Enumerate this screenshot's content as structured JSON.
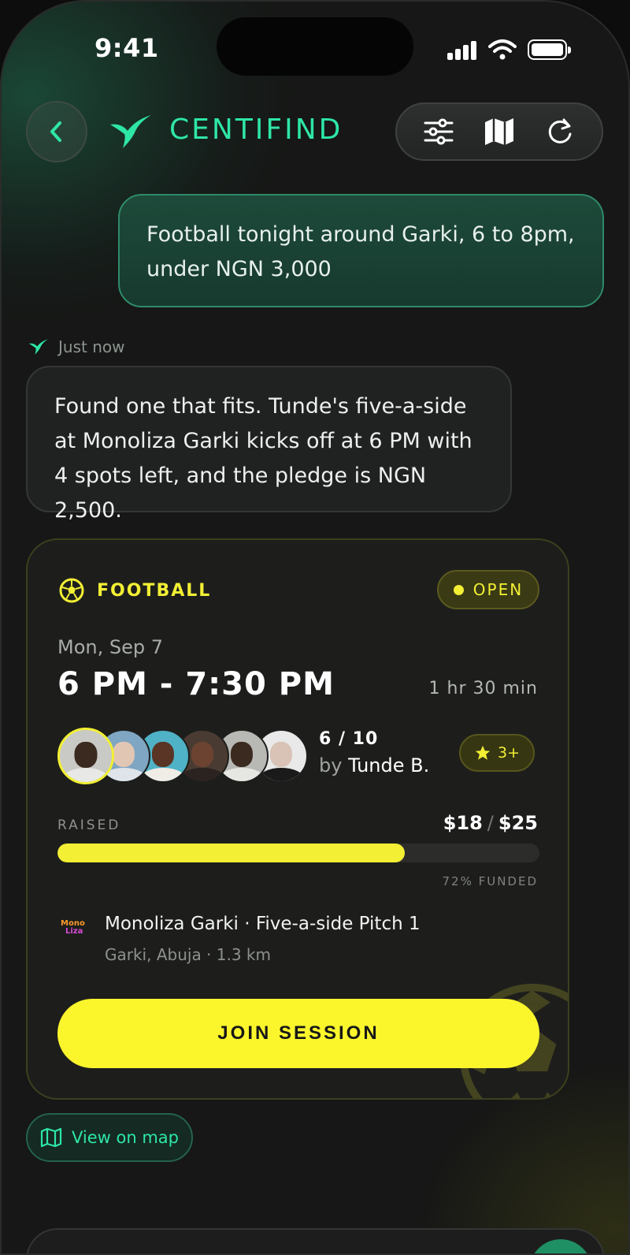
{
  "status_bar": {
    "time": "9:41"
  },
  "header": {
    "back_icon": "chevron-left-icon",
    "brand": "CENTIFIND",
    "tools": [
      "sliders-icon",
      "map-icon",
      "refresh-icon"
    ]
  },
  "chat": {
    "user_message": "Football tonight around Garki, 6 to 8pm, under NGN 3,000",
    "ai_timestamp": "Just now",
    "ai_message": "Found one that fits. Tunde's five-a-side at Monoliza Garki kicks off at 6 PM with 4 spots left, and the pledge is NGN 2,500."
  },
  "session": {
    "sport": "FOOTBALL",
    "status": "OPEN",
    "date": "Mon, Sep 7",
    "time_range": "6 PM - 7:30 PM",
    "duration": "1 hr 30 min",
    "players": "6 / 10",
    "host_prefix": "by",
    "host": "Tunde B.",
    "rating": "3+",
    "raised_label": "RAISED",
    "raised": "$18",
    "goal": "$25",
    "funded_fraction": 0.72,
    "funded_text": "72% FUNDED",
    "venue_logo": [
      "Mono",
      "Liza"
    ],
    "venue": "Monoliza Garki · Five-a-side Pitch 1",
    "address": "Garki, Abuja · 1.3 km",
    "cta": "JOIN SESSION"
  },
  "map_link": "View on map",
  "colors": {
    "accent_green": "#2ee6a6",
    "accent_yellow": "#f2ef34"
  }
}
